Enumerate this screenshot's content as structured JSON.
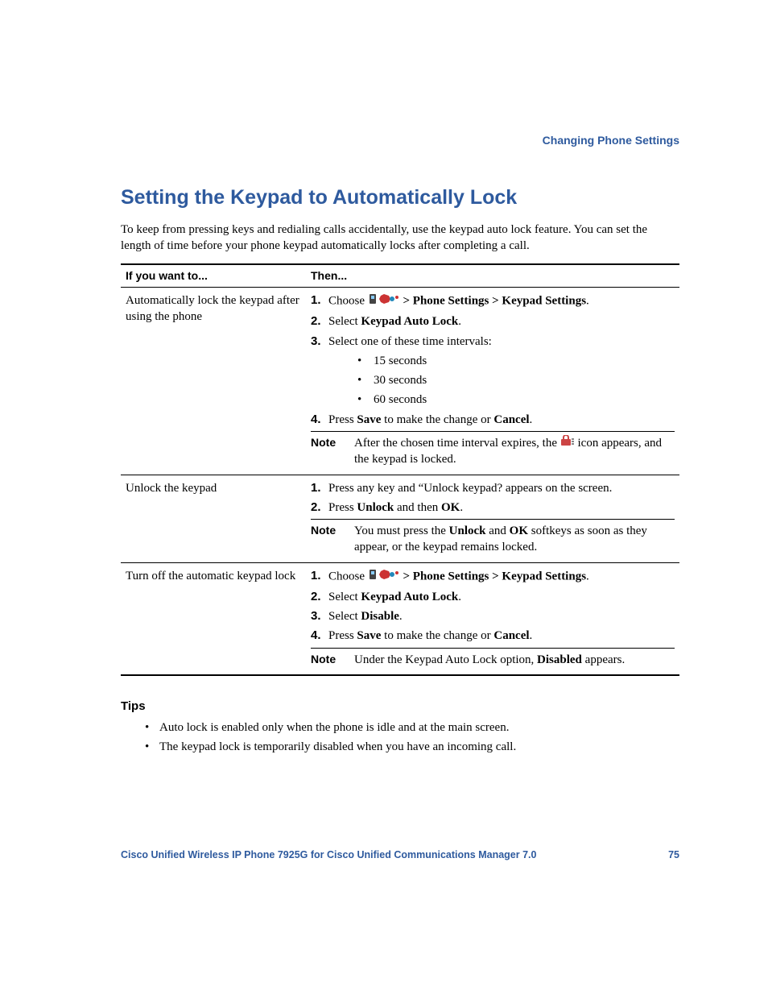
{
  "chapter_link": "Changing Phone Settings",
  "section_title": "Setting the Keypad to Automatically Lock",
  "intro": "To keep from pressing keys and redialing calls accidentally, use the keypad auto lock feature. You can set the length of time before your phone keypad automatically locks after completing a call.",
  "table": {
    "header_if": "If you want to...",
    "header_then": "Then...",
    "rows": [
      {
        "if": "Automatically lock the keypad after using the phone",
        "then": {
          "step1_prefix": "Choose ",
          "step1_suffix_bold": " > Phone Settings > Keypad Settings",
          "step1_end": ".",
          "step2_a": "Select ",
          "step2_b": "Keypad Auto Lock",
          "step2_c": ".",
          "step3": "Select one of these time intervals:",
          "bullets": [
            "15 seconds",
            "30 seconds",
            "60 seconds"
          ],
          "step4_a": "Press ",
          "step4_b": "Save",
          "step4_c": " to make the change or ",
          "step4_d": "Cancel",
          "step4_e": ".",
          "note_a": "After the chosen time interval expires, the ",
          "note_b": " icon appears, and the keypad is locked."
        }
      },
      {
        "if": "Unlock the keypad",
        "then": {
          "step1": "Press any key and “Unlock keypad? appears on the screen.",
          "step2_a": "Press ",
          "step2_b": "Unlock",
          "step2_c": " and then ",
          "step2_d": "OK",
          "step2_e": ".",
          "note_a": "You must press the ",
          "note_b": "Unlock",
          "note_c": " and ",
          "note_d": "OK",
          "note_e": " softkeys as soon as they appear, or the keypad remains locked."
        }
      },
      {
        "if": "Turn off the automatic keypad lock",
        "then": {
          "step1_prefix": "Choose ",
          "step1_suffix_bold": " > Phone Settings > Keypad Settings",
          "step1_end": ".",
          "step2_a": "Select ",
          "step2_b": "Keypad Auto Lock",
          "step2_c": ".",
          "step3_a": "Select ",
          "step3_b": "Disable",
          "step3_c": ".",
          "step4_a": "Press ",
          "step4_b": "Save",
          "step4_c": " to make the change or ",
          "step4_d": "Cancel",
          "step4_e": ".",
          "note_a": "Under the Keypad Auto Lock option, ",
          "note_b": "Disabled",
          "note_c": " appears."
        }
      }
    ]
  },
  "labels": {
    "num1": "1.",
    "num2": "2.",
    "num3": "3.",
    "num4": "4.",
    "note": "Note",
    "bullet": "•"
  },
  "tips": {
    "heading": "Tips",
    "items": [
      "Auto lock is enabled only when the phone is idle and at the main screen.",
      "The keypad lock is temporarily disabled when you have an incoming call."
    ]
  },
  "footer": {
    "book": "Cisco Unified Wireless IP Phone 7925G for Cisco Unified Communications Manager 7.0",
    "page": "75"
  }
}
